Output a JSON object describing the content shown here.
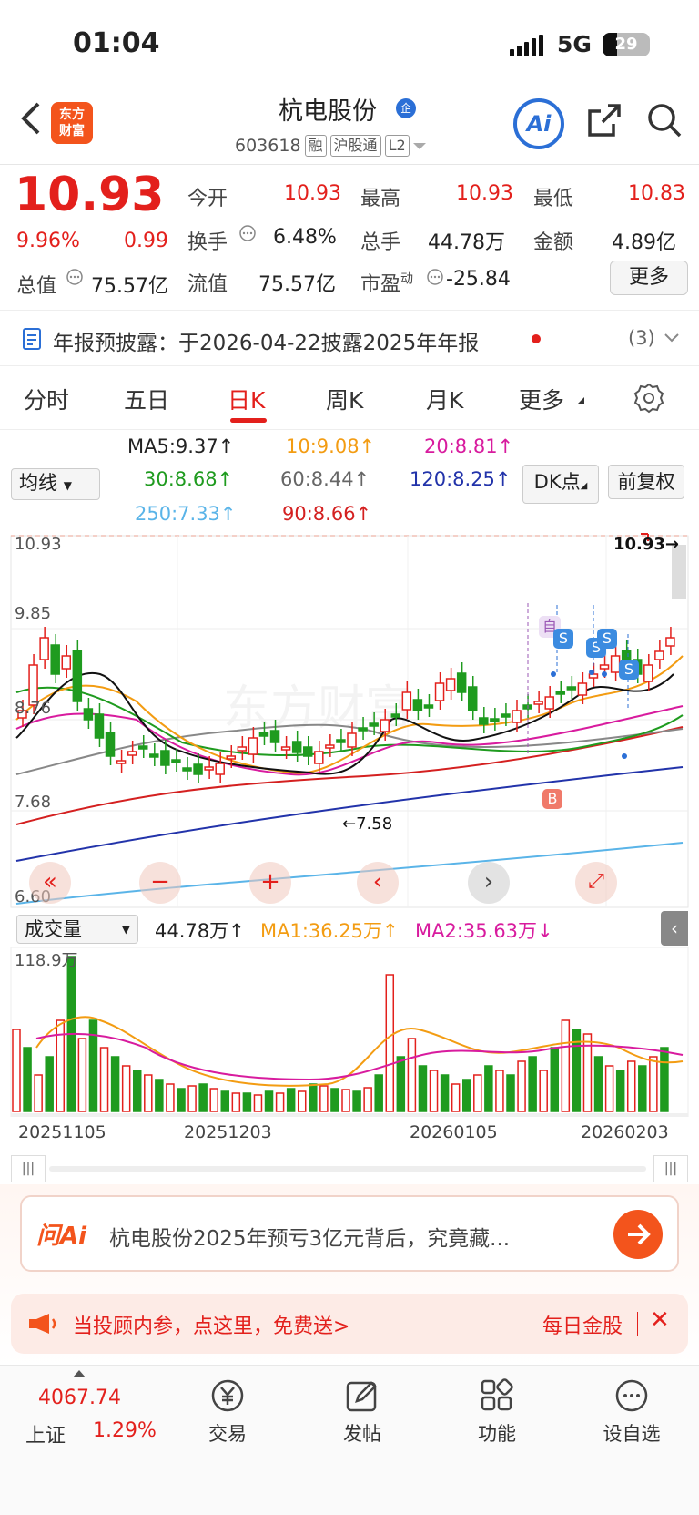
{
  "status": {
    "time": "01:04",
    "network": "5G",
    "battery": "29"
  },
  "header": {
    "logo": [
      "东方",
      "财富"
    ],
    "title": "杭电股份",
    "title_badge": "企",
    "code": "603618",
    "tags": [
      "融",
      "沪股通",
      "L2"
    ]
  },
  "quote": {
    "price": "10.93",
    "change_pct": "9.96%",
    "change": "0.99",
    "total_value_label": "总值",
    "total_value": "75.57亿",
    "fields": [
      {
        "label": "今开",
        "value": "10.93"
      },
      {
        "label": "最高",
        "value": "10.93"
      },
      {
        "label": "最低",
        "value": "10.83"
      },
      {
        "label": "换手",
        "value": "6.48%"
      },
      {
        "label": "总手",
        "value": "44.78万"
      },
      {
        "label": "金额",
        "value": "4.89亿"
      },
      {
        "label": "流值",
        "value": "75.57亿"
      },
      {
        "label": "市盈",
        "sup": "动",
        "value": "-25.84"
      }
    ],
    "more": "更多"
  },
  "banner": {
    "text": "年报预披露：于2026-04-22披露2025年年报",
    "count": "(3)"
  },
  "tabs": [
    "分时",
    "五日",
    "日K",
    "周K",
    "月K",
    "更多"
  ],
  "active_tab": "日K",
  "ma": {
    "select": "均线",
    "ma5": "MA5:9.37↑",
    "ma10": "10:9.08↑",
    "ma20": "20:8.81↑",
    "ma30": "30:8.68↑",
    "ma60": "60:8.44↑",
    "ma120": "120:8.25↑",
    "ma250": "250:7.33↑",
    "ma90": "90:8.66↑",
    "dk": "DK点",
    "fq": "前复权"
  },
  "kchart": {
    "y_labels": [
      "10.93",
      "9.85",
      "8.76",
      "7.68",
      "6.60"
    ],
    "last_label": "10.93→",
    "low_label": "←7.58",
    "marker_zi": "自",
    "marker_s": "S",
    "marker_b": "B"
  },
  "volume": {
    "select": "成交量",
    "value": "44.78万↑",
    "ma1": "MA1:36.25万↑",
    "ma2": "MA2:35.63万↓",
    "max_label": "118.9万"
  },
  "dates": [
    "20251105",
    "20251203",
    "20260105",
    "20260203"
  ],
  "ask": {
    "brand": "问Ai",
    "text": "杭电股份2025年预亏3亿元背后，究竟藏..."
  },
  "notice": {
    "text": "当投顾内参，点这里，免费送>",
    "right": "每日金股"
  },
  "bottom": {
    "index_value": "4067.74",
    "index_name": "上证",
    "index_pct": "1.29%",
    "items": [
      "交易",
      "发帖",
      "功能",
      "设自选"
    ]
  },
  "colors": {
    "up": "#e3201c",
    "down": "#1f9b1f",
    "accent": "#f3541c"
  }
}
